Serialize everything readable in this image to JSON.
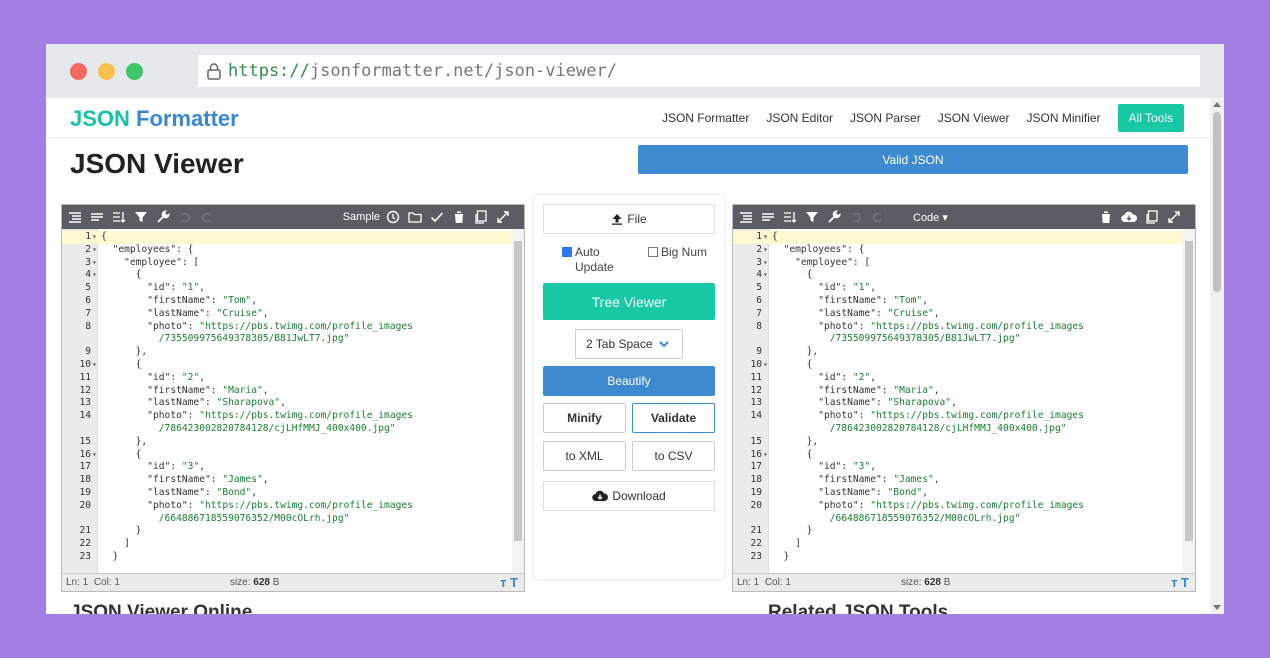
{
  "browser": {
    "url_scheme": "https://",
    "url_rest": "jsonformatter.net/json-viewer/"
  },
  "nav": {
    "brand_part1": "JSON",
    "brand_part2": " Formatter",
    "links": [
      "JSON Formatter",
      "JSON Editor",
      "JSON Parser",
      "JSON Viewer",
      "JSON Minifier"
    ],
    "all_tools": "All Tools"
  },
  "page_title": "JSON Viewer",
  "valid_label": "Valid JSON",
  "left_editor": {
    "sample_label": "Sample",
    "status": {
      "ln": "Ln: 1",
      "col": "Col: 1",
      "size_label": "size: ",
      "size_value": "628",
      "size_unit": " B"
    }
  },
  "right_editor": {
    "code_label": "Code ▾",
    "status": {
      "ln": "Ln: 1",
      "col": "Col: 1",
      "size_label": "size: ",
      "size_value": "628",
      "size_unit": " B"
    }
  },
  "code_lines": [
    {
      "n": "1",
      "f": "▾",
      "t": "{"
    },
    {
      "n": "2",
      "f": "▾",
      "t": "  \"employees\": {"
    },
    {
      "n": "3",
      "f": "▾",
      "t": "    \"employee\": ["
    },
    {
      "n": "4",
      "f": "▾",
      "t": "      {"
    },
    {
      "n": "5",
      "f": "",
      "t": "        \"id\": \"1\","
    },
    {
      "n": "6",
      "f": "",
      "t": "        \"firstName\": \"Tom\","
    },
    {
      "n": "7",
      "f": "",
      "t": "        \"lastName\": \"Cruise\","
    },
    {
      "n": "8",
      "f": "",
      "t": "        \"photo\": \"https://pbs.twimg.com/profile_images"
    },
    {
      "n": "",
      "f": "",
      "t": "          /735509975649378305/B81JwLT7.jpg\""
    },
    {
      "n": "9",
      "f": "",
      "t": "      },"
    },
    {
      "n": "10",
      "f": "▾",
      "t": "      {"
    },
    {
      "n": "11",
      "f": "",
      "t": "        \"id\": \"2\","
    },
    {
      "n": "12",
      "f": "",
      "t": "        \"firstName\": \"Maria\","
    },
    {
      "n": "13",
      "f": "",
      "t": "        \"lastName\": \"Sharapova\","
    },
    {
      "n": "14",
      "f": "",
      "t": "        \"photo\": \"https://pbs.twimg.com/profile_images"
    },
    {
      "n": "",
      "f": "",
      "t": "          /786423002820784128/cjLHfMMJ_400x400.jpg\""
    },
    {
      "n": "15",
      "f": "",
      "t": "      },"
    },
    {
      "n": "16",
      "f": "▾",
      "t": "      {"
    },
    {
      "n": "17",
      "f": "",
      "t": "        \"id\": \"3\","
    },
    {
      "n": "18",
      "f": "",
      "t": "        \"firstName\": \"James\","
    },
    {
      "n": "19",
      "f": "",
      "t": "        \"lastName\": \"Bond\","
    },
    {
      "n": "20",
      "f": "",
      "t": "        \"photo\": \"https://pbs.twimg.com/profile_images"
    },
    {
      "n": "",
      "f": "",
      "t": "          /664886718559076352/M00cOLrh.jpg\""
    },
    {
      "n": "21",
      "f": "",
      "t": "      }"
    },
    {
      "n": "22",
      "f": "",
      "t": "    ]"
    },
    {
      "n": "23",
      "f": "",
      "t": "  }"
    }
  ],
  "middle": {
    "file_label": "File",
    "auto_update": "Auto Update",
    "big_num": "Big Num",
    "tree_viewer": "Tree Viewer",
    "tab_space": "2 Tab Space",
    "beautify": "Beautify",
    "minify": "Minify",
    "validate": "Validate",
    "to_xml": "to XML",
    "to_csv": "to CSV",
    "download": "Download"
  },
  "bottom": {
    "left": "JSON Viewer Online",
    "right": "Related JSON Tools"
  },
  "colors": {
    "accent_green": "#17c8a6",
    "accent_blue": "#3d8ad0",
    "background": "#a47fe3"
  }
}
